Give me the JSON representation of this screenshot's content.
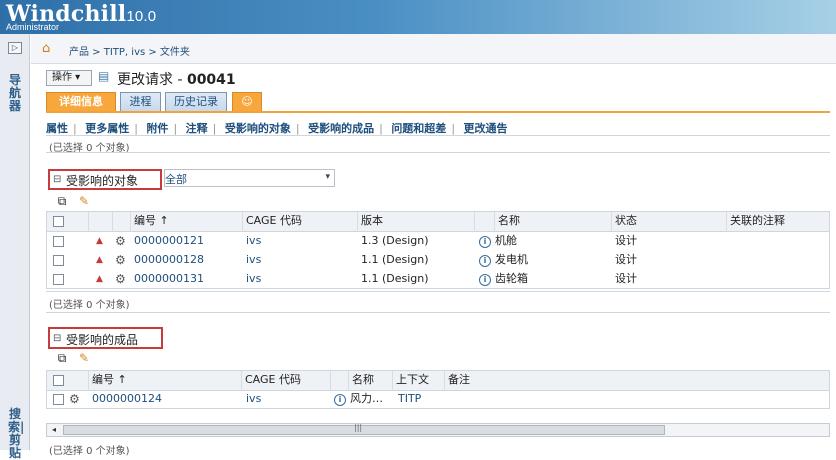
{
  "app": {
    "title": "Windchill",
    "version": "10.0",
    "user": "Administrator"
  },
  "leftnav": {
    "toggle": "▷",
    "top_label": "导航器",
    "bottom_label": "搜索|剪贴"
  },
  "breadcrumb": "产品 > TITP, ivs > 文件夹",
  "header": {
    "action_label": "操作 ▾",
    "title_prefix": "更改请求 - ",
    "title_number": "00041"
  },
  "tabs": [
    {
      "label": "详细信息",
      "active": true
    },
    {
      "label": "进程",
      "active": false
    },
    {
      "label": "历史记录",
      "active": false
    },
    {
      "label": "☺",
      "active": false
    }
  ],
  "subnav": [
    "属性",
    "更多属性",
    "附件",
    "注释",
    "受影响的对象",
    "受影响的成品",
    "问题和超差",
    "更改通告"
  ],
  "selection_note_top": "(已选择 0 个对象)",
  "section1": {
    "title": "受影响的对象",
    "filter": "全部",
    "columns": [
      "",
      "",
      "",
      "编号 ↑",
      "CAGE 代码",
      "版本",
      "",
      "名称",
      "状态",
      "关联的注释"
    ],
    "rows": [
      {
        "number": "0000000121",
        "cage": "ivs",
        "version": "1.3 (Design)",
        "name": "机舱",
        "status": "设计"
      },
      {
        "number": "0000000128",
        "cage": "ivs",
        "version": "1.1 (Design)",
        "name": "发电机",
        "status": "设计"
      },
      {
        "number": "0000000131",
        "cage": "ivs",
        "version": "1.1 (Design)",
        "name": "齿轮箱",
        "status": "设计"
      }
    ],
    "selection_note": "(已选择 0 个对象)"
  },
  "section2": {
    "title": "受影响的成品",
    "columns": [
      "",
      "编号 ↑",
      "CAGE 代码",
      "名称",
      "上下文",
      "备注"
    ],
    "rows": [
      {
        "number": "0000000124",
        "cage": "ivs",
        "name": "风力…",
        "context": "TITP"
      }
    ],
    "selection_note": "(已选择 0 个对象)"
  },
  "scroll": {
    "left": "◂",
    "grip": "|||"
  }
}
